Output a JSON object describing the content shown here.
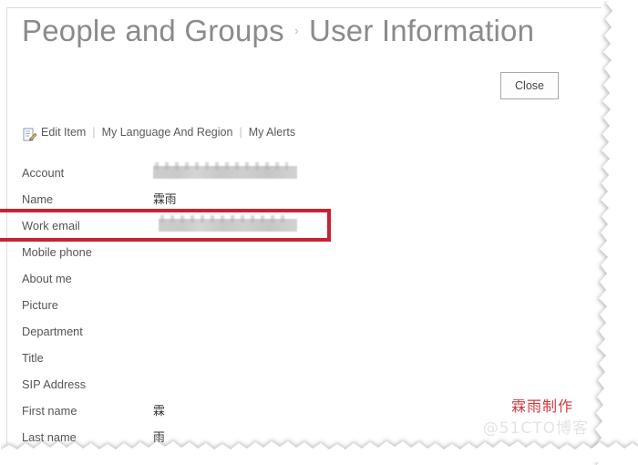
{
  "header": {
    "breadcrumb_root": "People and Groups",
    "breadcrumb_separator": "›",
    "breadcrumb_current": "User Information"
  },
  "actions": {
    "close_label": "Close"
  },
  "toolbar": {
    "edit_icon": "edit-item-icon",
    "edit_label": "Edit Item",
    "separator": "|",
    "language_label": "My Language And Region",
    "alerts_label": "My Alerts"
  },
  "fields": [
    {
      "label": "Account",
      "value": "",
      "redacted": true,
      "redact_width": 158
    },
    {
      "label": "Name",
      "value": "霖雨",
      "redacted": false,
      "redact_width": 0
    },
    {
      "label": "Work email",
      "value": "",
      "redacted": true,
      "redact_width": 152,
      "highlighted": true
    },
    {
      "label": "Mobile phone",
      "value": "",
      "redacted": false,
      "redact_width": 0
    },
    {
      "label": "About me",
      "value": "",
      "redacted": false,
      "redact_width": 0
    },
    {
      "label": "Picture",
      "value": "",
      "redacted": false,
      "redact_width": 0
    },
    {
      "label": "Department",
      "value": "",
      "redacted": false,
      "redact_width": 0
    },
    {
      "label": "Title",
      "value": "",
      "redacted": false,
      "redact_width": 0
    },
    {
      "label": "SIP Address",
      "value": "",
      "redacted": false,
      "redact_width": 0
    },
    {
      "label": "First name",
      "value": "霖",
      "redacted": false,
      "redact_width": 0
    },
    {
      "label": "Last name",
      "value": "雨",
      "redacted": false,
      "redact_width": 0
    }
  ],
  "watermarks": {
    "red_text": "霖雨制作",
    "gray_text": "@51CTO博客"
  },
  "colors": {
    "highlight_red": "#c62232",
    "title_gray": "#8b8b8b",
    "label_gray": "#555555",
    "redaction_gray": "#c8c8c8",
    "watermark_red": "#cf3a3f"
  }
}
